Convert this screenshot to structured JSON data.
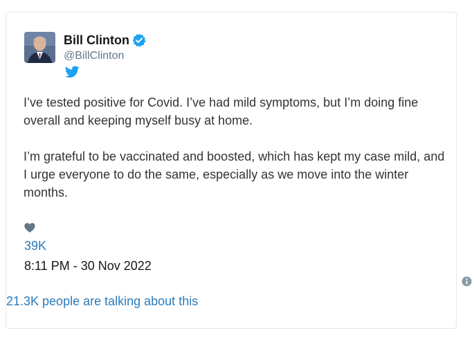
{
  "author": {
    "name": "Bill Clinton",
    "handle": "@BillClinton",
    "verified_icon": "verified-badge-icon",
    "platform_icon": "twitter-bird-icon",
    "avatar_icon": "avatar"
  },
  "tweet": {
    "paragraphs": [
      "I’ve tested positive for Covid. I’ve had mild symptoms, but I’m doing fine overall and keeping myself busy at home.",
      "I’m grateful to be vaccinated and boosted, which has kept my case mild, and I urge everyone to do the same, especially as we move into the winter months."
    ],
    "like_icon": "heart-icon",
    "like_count": "39K",
    "timestamp": "8:11 PM - 30 Nov 2022"
  },
  "footer": {
    "info_icon": "info-icon",
    "talking_text": "21.3K people are talking about this"
  },
  "colors": {
    "link": "#2b7bb9",
    "twitter_blue": "#1da1f2",
    "muted": "#657786",
    "text": "#333333"
  }
}
